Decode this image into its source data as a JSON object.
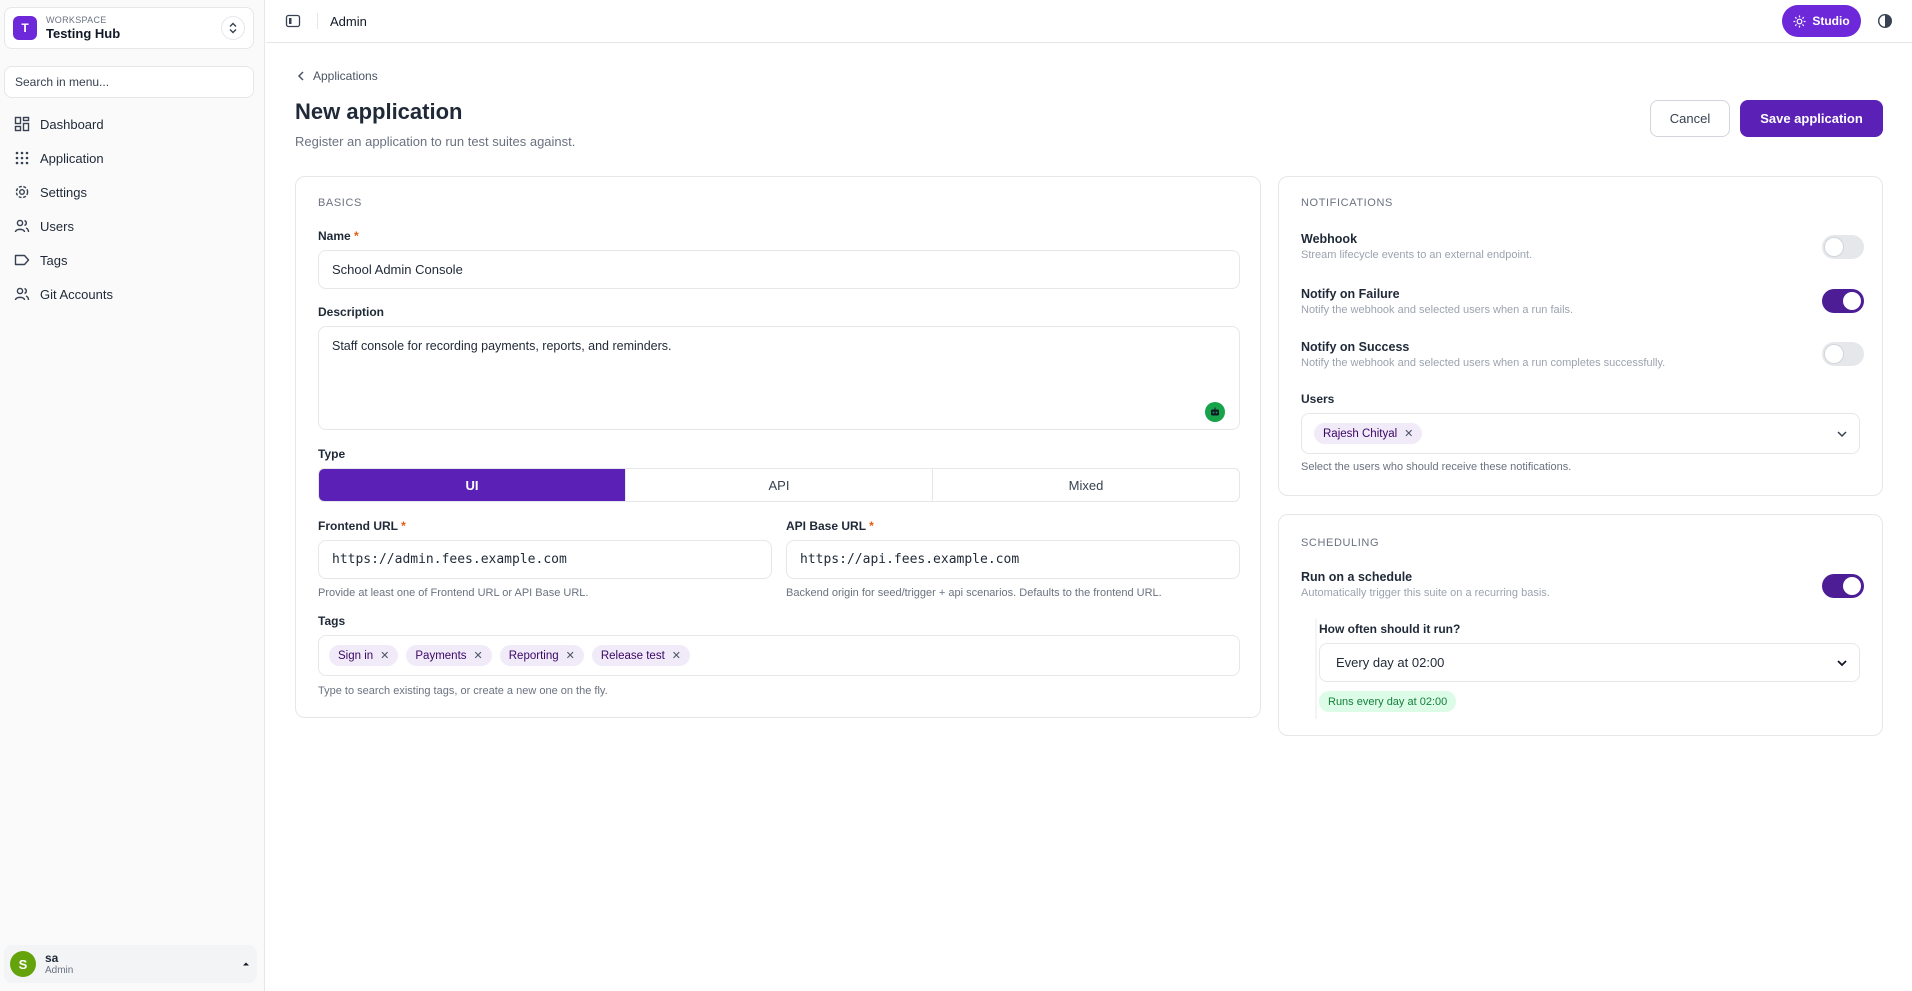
{
  "workspace": {
    "caption": "WORKSPACE",
    "name": "Testing Hub",
    "logo_letter": "T"
  },
  "sidebar": {
    "search_placeholder": "Search in menu...",
    "items": [
      {
        "label": "Dashboard",
        "icon": "dashboard-icon"
      },
      {
        "label": "Application",
        "icon": "grid-icon"
      },
      {
        "label": "Settings",
        "icon": "gear-icon"
      },
      {
        "label": "Users",
        "icon": "users-icon"
      },
      {
        "label": "Tags",
        "icon": "tag-icon"
      },
      {
        "label": "Git Accounts",
        "icon": "users-icon"
      }
    ]
  },
  "user": {
    "initial": "S",
    "name": "sa",
    "role": "Admin"
  },
  "topbar": {
    "title": "Admin",
    "studio_label": "Studio"
  },
  "page": {
    "back_label": "Applications",
    "title": "New application",
    "subtitle": "Register an application to run test suites against.",
    "cancel_label": "Cancel",
    "save_label": "Save application"
  },
  "basics": {
    "section": "BASICS",
    "name_label": "Name",
    "name_value": "School Admin Console",
    "description_label": "Description",
    "description_value": "Staff console for recording payments, reports, and reminders.",
    "type_label": "Type",
    "type_options": [
      "UI",
      "API",
      "Mixed"
    ],
    "type_selected": "UI",
    "frontend_label": "Frontend URL",
    "frontend_value": "https://admin.fees.example.com",
    "frontend_help": "Provide at least one of Frontend URL or API Base URL.",
    "api_label": "API Base URL",
    "api_value": "https://api.fees.example.com",
    "api_help": "Backend origin for seed/trigger + api scenarios. Defaults to the frontend URL.",
    "tags_label": "Tags",
    "tags": [
      "Sign in",
      "Payments",
      "Reporting",
      "Release test"
    ],
    "tags_help": "Type to search existing tags, or create a new one on the fly.",
    "required_mark": "*"
  },
  "notifications": {
    "section": "NOTIFICATIONS",
    "webhook_title": "Webhook",
    "webhook_desc": "Stream lifecycle events to an external endpoint.",
    "webhook_on": false,
    "failure_title": "Notify on Failure",
    "failure_desc": "Notify the webhook and selected users when a run fails.",
    "failure_on": true,
    "success_title": "Notify on Success",
    "success_desc": "Notify the webhook and selected users when a run completes successfully.",
    "success_on": false,
    "users_label": "Users",
    "selected_user": "Rajesh Chityal",
    "users_help": "Select the users who should receive these notifications."
  },
  "scheduling": {
    "section": "SCHEDULING",
    "schedule_title": "Run on a schedule",
    "schedule_desc": "Automatically trigger this suite on a recurring basis.",
    "schedule_on": true,
    "frequency_label": "How often should it run?",
    "frequency_value": "Every day at 02:00",
    "summary_badge": "Runs every day at 02:00"
  },
  "colors": {
    "accent": "#5b21b6",
    "studio": "#6d28d9",
    "success_bg": "#dcfce7",
    "success_text": "#15803d"
  }
}
